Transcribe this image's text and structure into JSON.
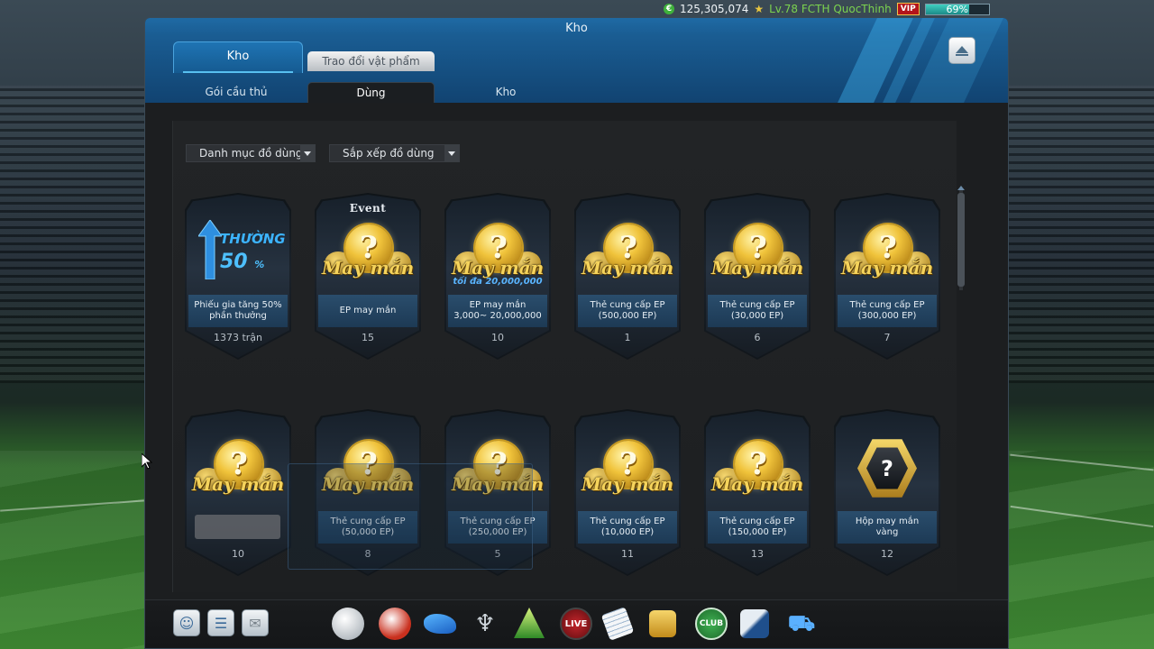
{
  "status": {
    "currency": "125,305,074",
    "level_player": "Lv.78 FCTH QuocThinh",
    "vip": "VIP",
    "progress_text": "69%",
    "progress_value": 0.69
  },
  "window": {
    "title": "Kho",
    "tabs": [
      {
        "label": "Kho",
        "active": true
      },
      {
        "label": "Trao đổi vật phẩm",
        "active": false
      }
    ],
    "subtabs": [
      {
        "label": "Gói cầu thủ",
        "active": false
      },
      {
        "label": "Dùng",
        "active": true
      },
      {
        "label": "Kho",
        "active": false
      }
    ]
  },
  "filters": {
    "category": "Danh mục đồ dùng",
    "sort": "Sắp xếp đồ dùng"
  },
  "items": [
    {
      "art": "boost",
      "art_word": "THƯỜNG",
      "art_pct": "50",
      "art_pct_unit": "%",
      "label": "Phiếu gia tăng 50% phần thưởng",
      "count": "1373 trận"
    },
    {
      "art": "coin",
      "tag": "Event",
      "art_word": "May mắn",
      "label": "EP may mắn",
      "count": "15"
    },
    {
      "art": "coin",
      "art_word": "May mắn",
      "art_sub": "tối đa 20,000,000",
      "label": "EP may mắn 3,000~ 20,000,000",
      "count": "10"
    },
    {
      "art": "coin",
      "art_word": "May mắn",
      "label": "Thẻ cung cấp EP (500,000 EP)",
      "count": "1"
    },
    {
      "art": "coin",
      "art_word": "May mắn",
      "label": "Thẻ cung cấp EP (30,000 EP)",
      "count": "6"
    },
    {
      "art": "coin",
      "art_word": "May mắn",
      "label": "Thẻ cung cấp EP (300,000 EP)",
      "count": "7"
    },
    {
      "art": "coin",
      "art_word": "May mắn",
      "label": "",
      "count": "10"
    },
    {
      "art": "coin",
      "art_word": "May mắn",
      "label": "Thẻ cung cấp EP (50,000 EP)",
      "count": "8"
    },
    {
      "art": "coin",
      "art_word": "May mắn",
      "label": "Thẻ cung cấp EP (250,000 EP)",
      "count": "5"
    },
    {
      "art": "coin",
      "art_word": "May mắn",
      "label": "Thẻ cung cấp EP (10,000 EP)",
      "count": "11"
    },
    {
      "art": "coin",
      "art_word": "May mắn",
      "label": "Thẻ cung cấp EP (150,000 EP)",
      "count": "13"
    },
    {
      "art": "hex",
      "label": "Hộp may mắn vàng",
      "count": "12"
    }
  ],
  "bottom_nav": {
    "utility": [
      "friends-icon",
      "chat-icon",
      "mail-icon"
    ],
    "main": [
      "whistle-icon",
      "ball-icon",
      "boots-icon",
      "trophy-icon",
      "league-icon",
      "live-icon",
      "notes-icon",
      "shirt-icon",
      "club-icon",
      "player-icon",
      "shop-cart-icon"
    ],
    "live_label": "LIVE",
    "club_label": "CLUB"
  }
}
